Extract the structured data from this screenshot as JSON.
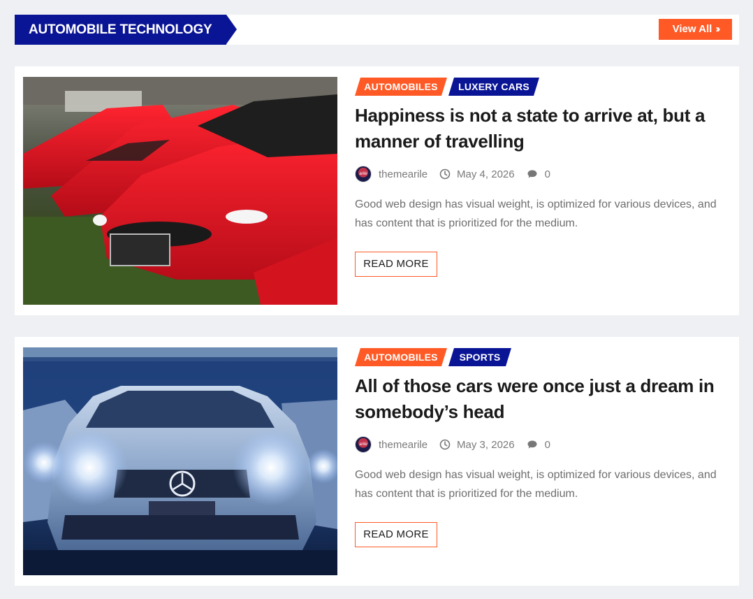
{
  "section": {
    "title": "AUTOMOBILE TECHNOLOGY",
    "view_all": "View All",
    "view_all_icon": "double-chevron-right-icon"
  },
  "colors": {
    "accent": "#ff5a26",
    "navy": "#0a1595",
    "page_bg": "#eef0f3"
  },
  "posts": [
    {
      "categories": [
        {
          "label": "AUTOMOBILES",
          "color": "orange"
        },
        {
          "label": "LUXERY CARS",
          "color": "navy"
        }
      ],
      "title": "Happiness is not a state to arrive at, but a manner of travelling",
      "author": "themearile",
      "date": "May 4, 2026",
      "comments": "0",
      "excerpt": "Good web design has visual weight, is optimized for various devices, and has content that is prioritized for the medium.",
      "read_more": "READ MORE",
      "image": "red-sports-cars-photo"
    },
    {
      "categories": [
        {
          "label": "AUTOMOBILES",
          "color": "orange"
        },
        {
          "label": "SPORTS",
          "color": "navy"
        }
      ],
      "title": "All of those cars were once just a dream in somebody’s head",
      "author": "themearile",
      "date": "May 3, 2026",
      "comments": "0",
      "excerpt": "Good web design has visual weight, is optimized for various devices, and has content that is prioritized for the medium.",
      "read_more": "READ MORE",
      "image": "silver-mercedes-headlights-photo"
    }
  ]
}
